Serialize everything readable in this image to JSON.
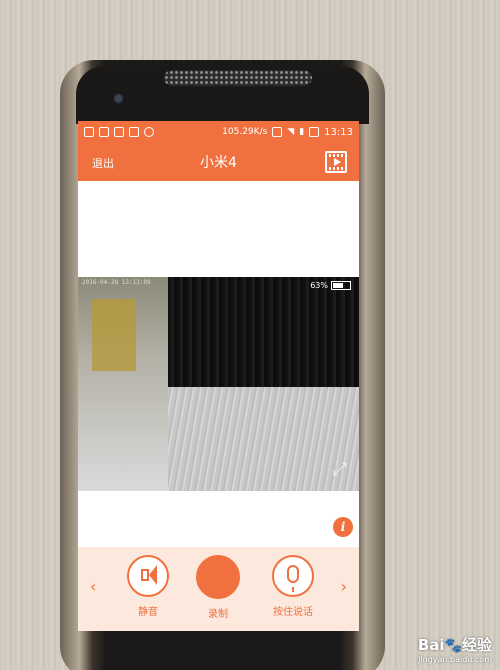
{
  "statusbar": {
    "speed": "105.29K/s",
    "time": "13:13",
    "icons": [
      "notification-icon",
      "lock-icon",
      "upload-icon",
      "image-icon",
      "wechat-icon",
      "vibrate-icon",
      "wifi-icon",
      "signal-icon",
      "battery-icon"
    ]
  },
  "header": {
    "exit_label": "退出",
    "title": "小米4",
    "video_icon": "video-record-icon"
  },
  "video": {
    "timestamp": "2016-04-28 13:13:09",
    "battery_percent_text": "63%",
    "battery_level": 0.63
  },
  "controls": {
    "mute_label": "静音",
    "record_label": "录制",
    "talk_label": "按住说话",
    "prev_arrow": "‹",
    "next_arrow": "›"
  },
  "watermark": {
    "main": "Bai",
    "main2": "经验",
    "site": "jingyan.baidu.com"
  },
  "colors": {
    "accent": "#f0713f",
    "control_bg": "#fde8dd"
  }
}
